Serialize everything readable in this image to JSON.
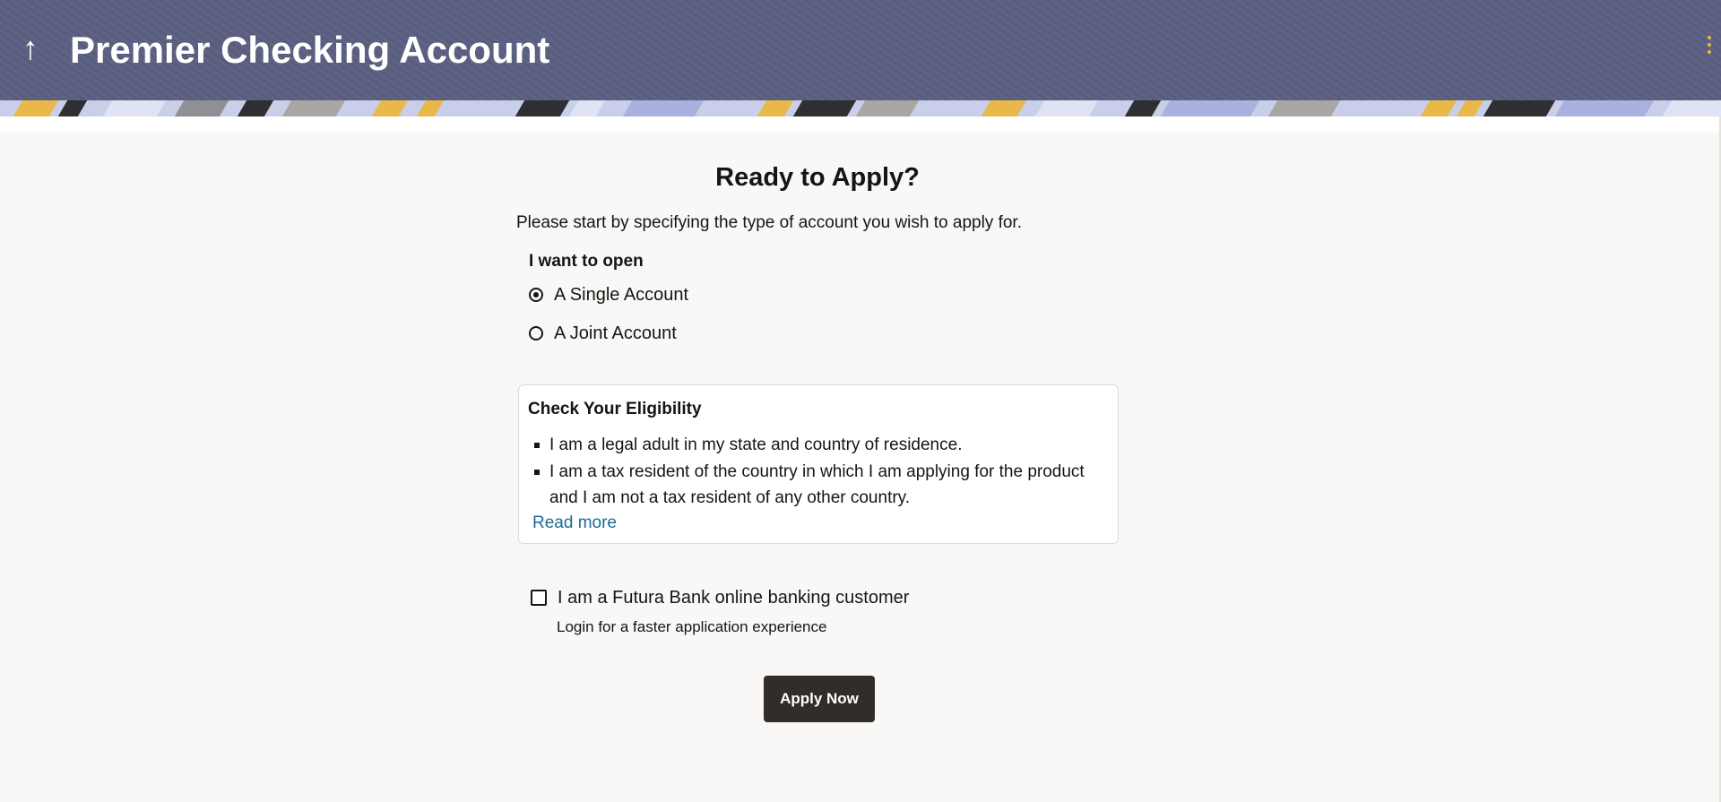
{
  "header": {
    "back_icon": "arrow-up-icon",
    "title": "Premier Checking Account",
    "menu_icon": "kebab-menu-icon",
    "colors": {
      "header_bg": "#5b5f81",
      "accent_yellow": "#e8b84a"
    }
  },
  "main": {
    "title": "Ready to Apply?",
    "intro": "Please start by specifying the type of account you wish to apply for.",
    "account_type": {
      "label": "I want to open",
      "options": [
        {
          "label": "A Single Account",
          "selected": true
        },
        {
          "label": "A Joint Account",
          "selected": false
        }
      ]
    },
    "eligibility": {
      "title": "Check Your Eligibility",
      "items": [
        "I am a legal adult in my state and country of residence.",
        "I am a tax resident of the country in which I am applying for the product and I am not a tax resident of any other country."
      ],
      "read_more": "Read more"
    },
    "customer": {
      "label": "I am a Futura Bank online banking customer",
      "checked": false,
      "hint": "Login for a faster application experience"
    },
    "apply_button": "Apply Now",
    "colors": {
      "button_bg": "#312d2a",
      "link": "#1a6b96"
    }
  }
}
